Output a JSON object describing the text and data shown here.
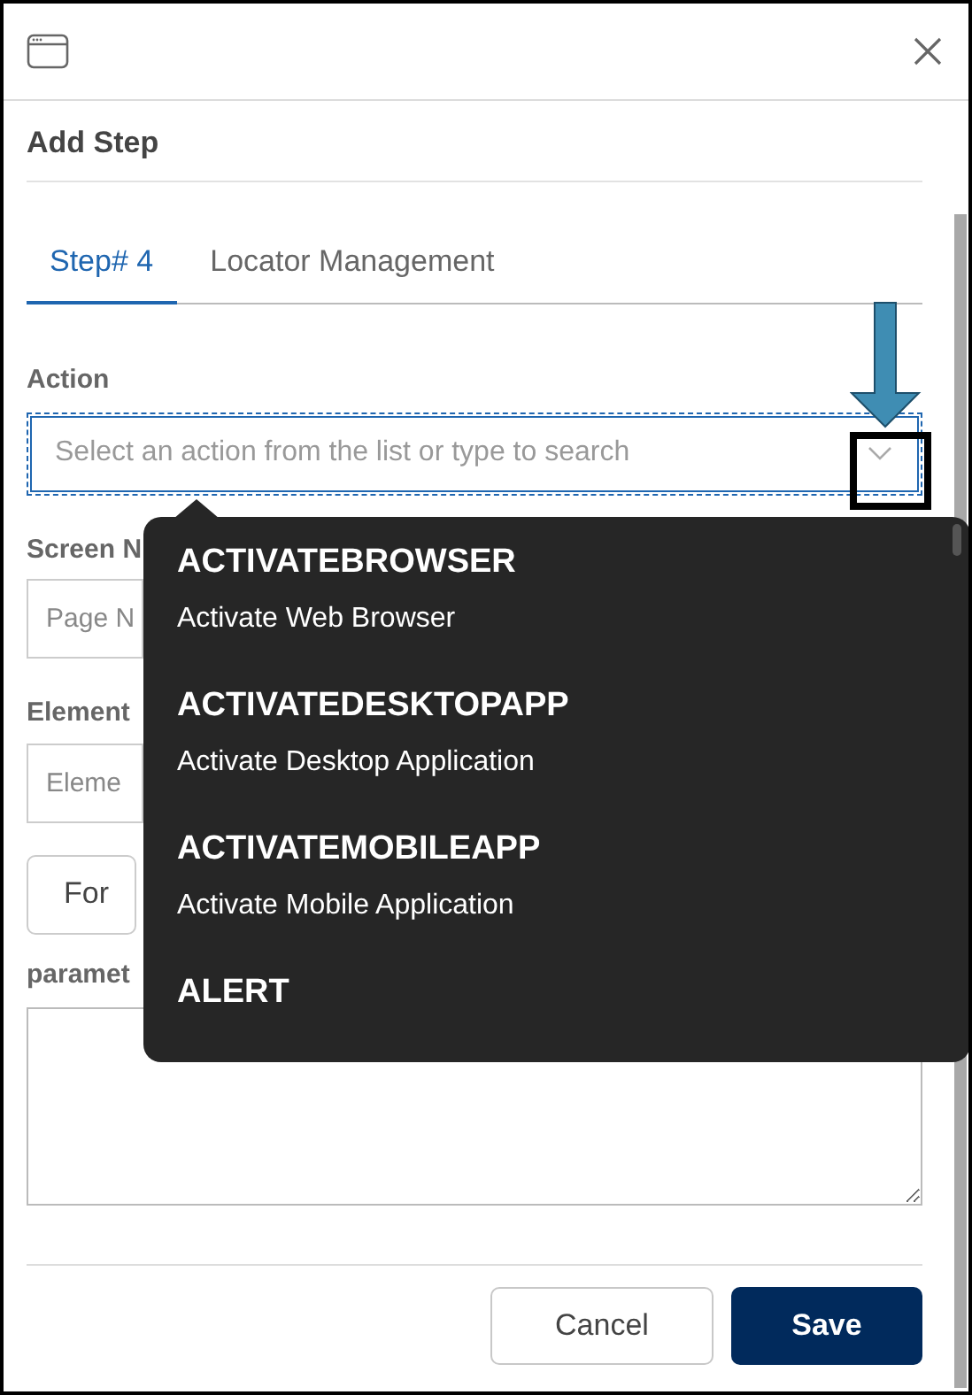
{
  "dialog": {
    "title": "Add Step"
  },
  "tabs": [
    {
      "label": "Step# 4",
      "selected": true
    },
    {
      "label": "Locator Management",
      "selected": false
    }
  ],
  "action": {
    "label": "Action",
    "placeholder": "Select an action from the list or type to search"
  },
  "screen_name": {
    "label": "Screen N",
    "placeholder": "Page N"
  },
  "element": {
    "label": "Element",
    "placeholder": "Eleme"
  },
  "format_button": "For",
  "parameters": {
    "label": "paramet"
  },
  "dropdown": [
    {
      "name": "ACTIVATEBROWSER",
      "description": "Activate Web Browser"
    },
    {
      "name": "ACTIVATEDESKTOPAPP",
      "description": "Activate Desktop Application"
    },
    {
      "name": "ACTIVATEMOBILEAPP",
      "description": "Activate Mobile Application"
    },
    {
      "name": "ALERT"
    }
  ],
  "buttons": [
    {
      "label": "Cancel",
      "kind": "secondary"
    },
    {
      "label": "Save",
      "kind": "primary"
    }
  ]
}
